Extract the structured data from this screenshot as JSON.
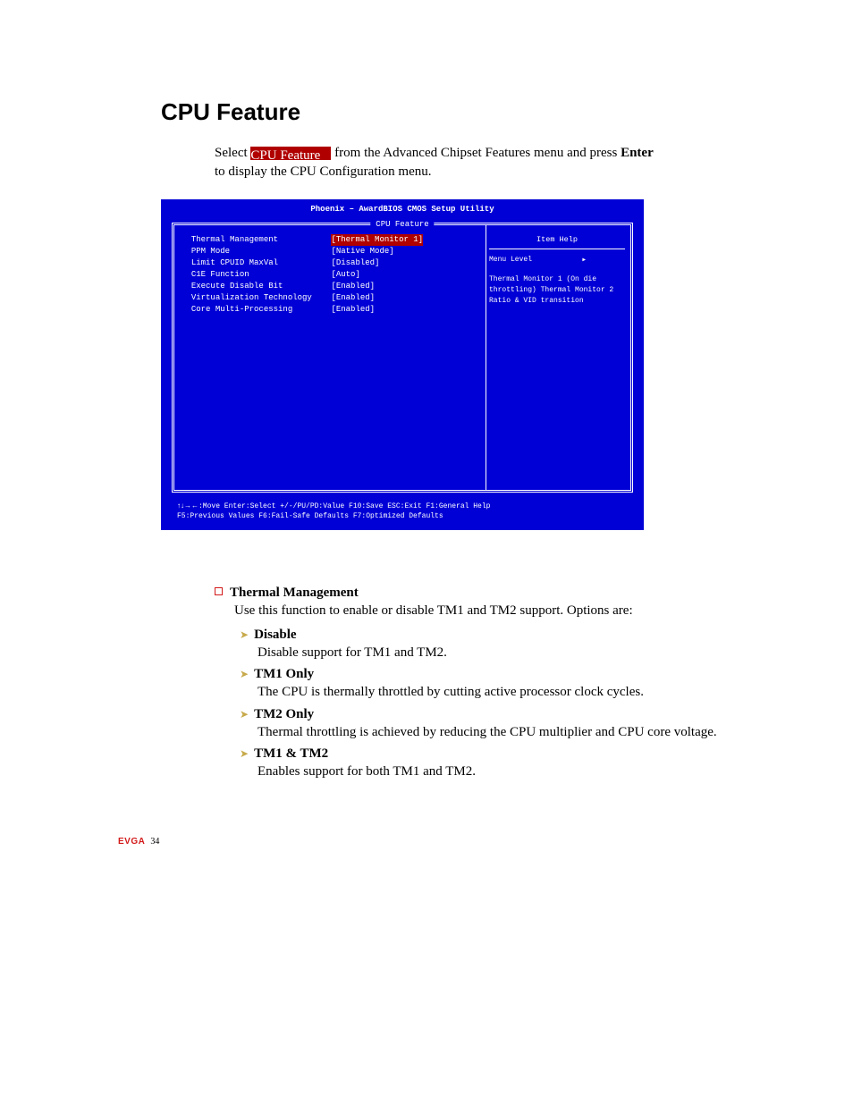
{
  "heading": "CPU Feature",
  "intro": {
    "pre": "Select ",
    "highlight": "CPU Feature",
    "post1": " from the Advanced Chipset Features menu and press ",
    "enter": "Enter",
    "post2": " to display the CPU Configuration menu."
  },
  "bios": {
    "title": "Phoenix – AwardBIOS CMOS Setup Utility",
    "subtitle": "CPU Feature",
    "rows": [
      {
        "label": "Thermal Management",
        "value": "[Thermal Monitor 1]",
        "selected": true
      },
      {
        "label": "PPM Mode",
        "value": "[Native Mode]"
      },
      {
        "label": "Limit CPUID MaxVal",
        "value": "[Disabled]"
      },
      {
        "label": "C1E Function",
        "value": "[Auto]"
      },
      {
        "label": "Execute Disable Bit",
        "value": "[Enabled]"
      },
      {
        "label": "Virtualization Technology",
        "value": "[Enabled]"
      },
      {
        "label": "Core Multi-Processing",
        "value": "[Enabled]"
      }
    ],
    "help_head": "Item Help",
    "help_level": "Menu Level",
    "help_text": "Thermal Monitor 1 (On die throttling) Thermal Monitor 2 Ratio & VID transition",
    "footer1": "↑↓→←:Move Enter:Select +/-/PU/PD:Value F10:Save ESC:Exit F1:General Help",
    "footer2": "      F5:Previous Values    F6:Fail-Safe Defaults   F7:Optimized Defaults"
  },
  "explain": {
    "l1_title": "Thermal Management",
    "l1_body": "Use this function to enable or disable TM1 and TM2 support. Options are:",
    "subs": [
      {
        "title": "Disable",
        "body": "Disable support for TM1 and TM2."
      },
      {
        "title": "TM1 Only",
        "body": "The CPU is thermally throttled by cutting active processor clock cycles."
      },
      {
        "title": "TM2 Only",
        "body": "Thermal throttling is achieved by reducing the CPU multiplier and CPU core voltage."
      },
      {
        "title": "TM1 & TM2",
        "body": "Enables support for both TM1 and TM2."
      }
    ]
  },
  "footer": {
    "brand": "EVGA",
    "page": "34"
  }
}
